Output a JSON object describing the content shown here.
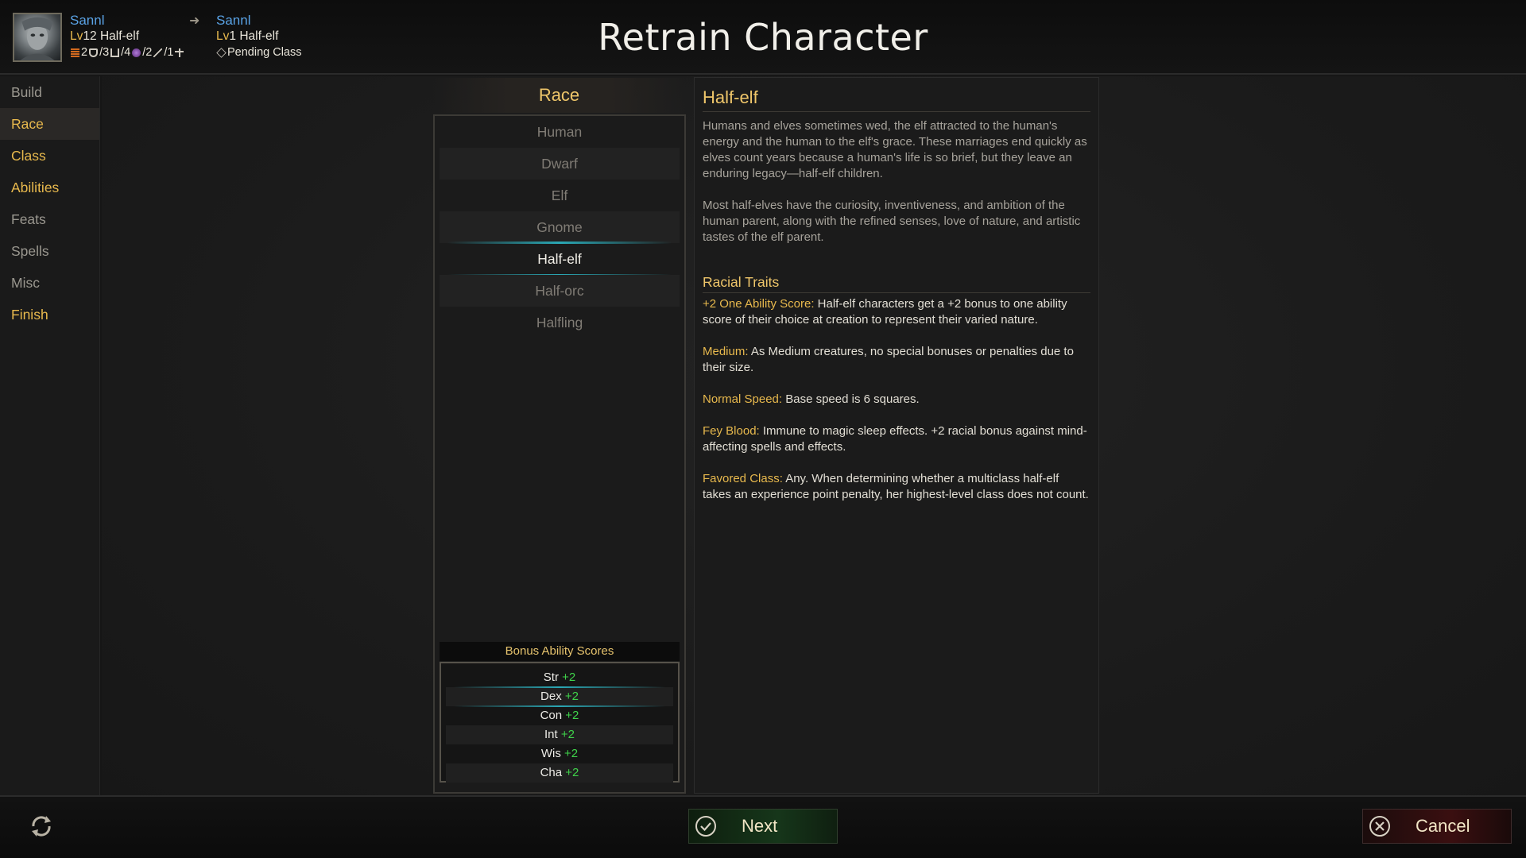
{
  "header": {
    "title": "Retrain Character",
    "current": {
      "name": "Sannl",
      "level_prefix": "Lv",
      "level": "12",
      "race": "Half-elf",
      "stats": [
        "2",
        "/3",
        "/4",
        "/2",
        "/1"
      ]
    },
    "target": {
      "name": "Sannl",
      "level_prefix": "Lv",
      "level": "1",
      "race": "Half-elf",
      "pending": "Pending Class"
    }
  },
  "sidebar": {
    "items": [
      {
        "label": "Build"
      },
      {
        "label": "Race"
      },
      {
        "label": "Class"
      },
      {
        "label": "Abilities"
      },
      {
        "label": "Feats"
      },
      {
        "label": "Spells"
      },
      {
        "label": "Misc"
      },
      {
        "label": "Finish"
      }
    ]
  },
  "race_panel": {
    "title": "Race",
    "items": [
      "Human",
      "Dwarf",
      "Elf",
      "Gnome",
      "Half-elf",
      "Half-orc",
      "Halfling"
    ],
    "selected": "Half-elf",
    "bonus_title": "Bonus Ability Scores",
    "bonus": [
      {
        "stat": "Str",
        "value": "+2"
      },
      {
        "stat": "Dex",
        "value": "+2"
      },
      {
        "stat": "Con",
        "value": "+2"
      },
      {
        "stat": "Int",
        "value": "+2"
      },
      {
        "stat": "Wis",
        "value": "+2"
      },
      {
        "stat": "Cha",
        "value": "+2"
      }
    ]
  },
  "description": {
    "title": "Half-elf",
    "para1": "Humans and elves sometimes wed, the elf attracted to the human's energy and the human to the elf's grace. These marriages end quickly as elves count years because a human's life is so brief, but they leave an enduring legacy—half-elf children.",
    "para2": "Most half-elves have the curiosity, inventiveness, and ambition of the human parent, along with the refined senses, love of nature, and artistic tastes of the elf parent.",
    "traits_title": "Racial Traits",
    "traits": [
      {
        "name": "+2 One Ability Score:",
        "text": " Half-elf characters get a +2 bonus to one ability score of their choice at creation to represent their varied nature."
      },
      {
        "name": "Medium:",
        "text": " As Medium creatures, no special bonuses or penalties due to their size."
      },
      {
        "name": "Normal Speed:",
        "text": " Base speed is 6 squares."
      },
      {
        "name": "Fey Blood:",
        "text": " Immune to magic sleep effects. +2 racial bonus against mind-affecting spells and effects."
      },
      {
        "name": "Favored Class:",
        "text": " Any. When determining whether a multiclass half-elf  takes an experience point penalty, her highest-level class does not count."
      }
    ]
  },
  "footer": {
    "next_label": "Next",
    "cancel_label": "Cancel"
  },
  "colors": {
    "gold": "#e8b94d",
    "blue_name": "#5aa3e6",
    "green_bonus": "#3fd24a",
    "selection_glow": "#2aa7b4"
  }
}
